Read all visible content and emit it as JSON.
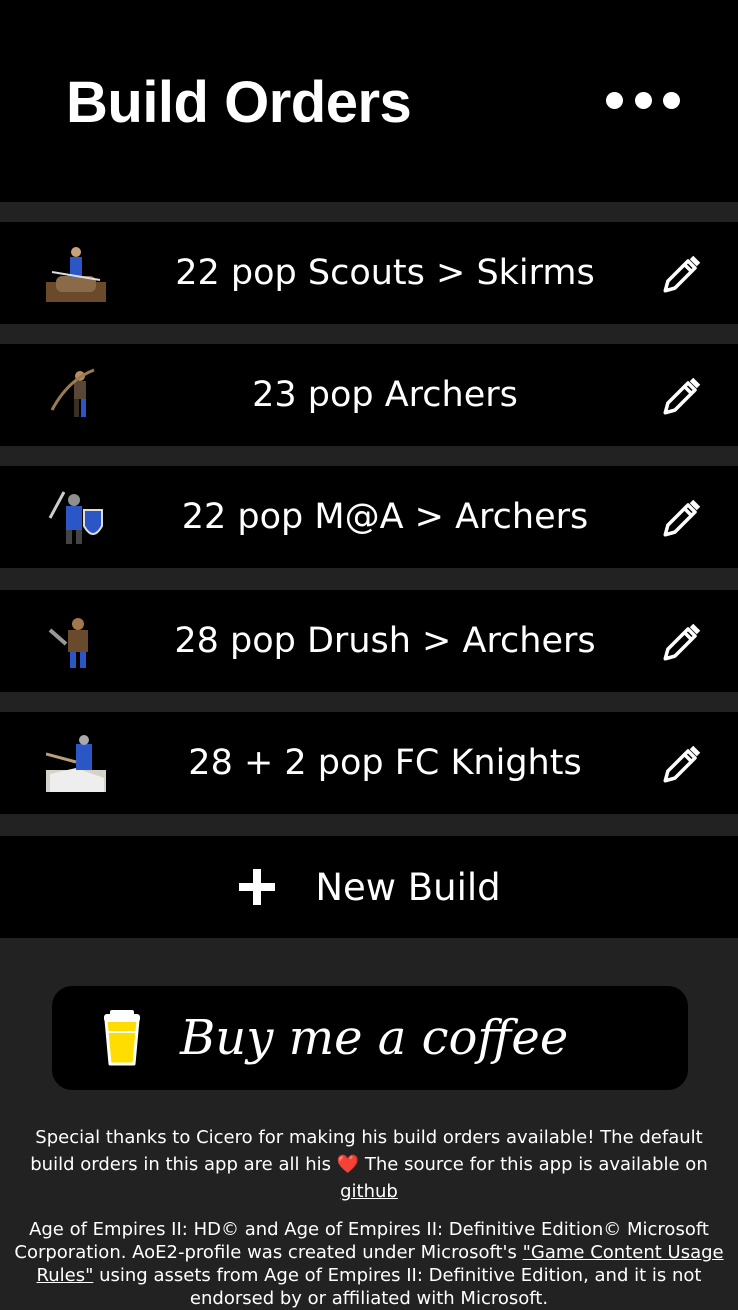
{
  "header": {
    "title": "Build Orders",
    "menu_icon": "ellipsis-icon"
  },
  "builds": [
    {
      "name": "22 pop Scouts > Skirms",
      "unit_icon": "scout-cavalry-icon"
    },
    {
      "name": "23 pop Archers",
      "unit_icon": "archer-icon"
    },
    {
      "name": "22 pop M@A > Archers",
      "unit_icon": "man-at-arms-icon"
    },
    {
      "name": "28 pop Drush > Archers",
      "unit_icon": "militia-icon"
    },
    {
      "name": "28 + 2 pop FC Knights",
      "unit_icon": "knight-icon"
    }
  ],
  "new_build": {
    "label": "New Build"
  },
  "coffee": {
    "label": "Buy me a coffee"
  },
  "footer": {
    "thanks_part1": "Special thanks to Cicero for making his build orders available! The default build orders in this app are all his",
    "heart": "❤️",
    "thanks_part2": "The source for this app is available on",
    "github_link": "github",
    "legal_part1": "Age of Empires II: HD© and Age of Empires II: Definitive Edition© Microsoft Corporation. AoE2-profile was created under Microsoft's",
    "legal_link": "\"Game Content Usage Rules\"",
    "legal_part2": "using assets from Age of Empires II: Definitive Edition, and it is not endorsed by or affiliated with Microsoft."
  },
  "colors": {
    "background": "#222222",
    "row": "#000000",
    "text": "#ffffff"
  }
}
